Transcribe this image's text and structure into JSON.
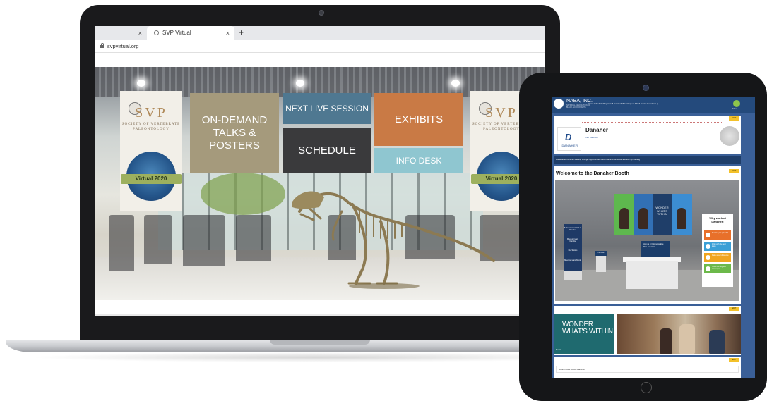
{
  "browser": {
    "tabs": [
      {
        "label": ""
      },
      {
        "label": "SVP Virtual"
      }
    ],
    "new_tab": "+",
    "close": "×",
    "url": "svpvirtual.org"
  },
  "svp_lobby": {
    "banner_left": {
      "logo": "SVP",
      "subtitle": "SOCIETY OF VERTEBRATE PALEONTOLOGY",
      "ribbon": "Virtual 2020"
    },
    "banner_right": {
      "logo": "SVP",
      "subtitle": "SOCIETY OF VERTEBRATE PALEONTOLOGY",
      "ribbon": "Virtual 2020"
    },
    "tiles": {
      "on_demand": "ON-DEMAND TALKS & POSTERS",
      "next_live": "NEXT LIVE SESSION",
      "schedule": "SCHEDULE",
      "exhibits": "EXHIBITS",
      "info_desk": "INFO DESK"
    }
  },
  "naba": {
    "org_name": "NABA, INC.",
    "org_sub": "NATIONAL ASSOCIATION OF BLACK ACCOUNTANTS",
    "nav": "Home   Schedule   Programs & Events ▾   Virtual Expo ▾   NABA Center   Help Desk  |  ",
    "hello": "Hello ▾",
    "edit_label": "EDIT",
    "company": "Danaher",
    "company_logo": "DANAHER",
    "links": "Info    Calendar",
    "menu": "Home   About Danaher   Meeting Lounge   Opportunities Within Danaher   Schedule a Follow Up Meeting",
    "welcome": "Welcome to the Danaher Booth",
    "kiosk_left": [
      "5 Reasons to Work at Danaher",
      "Meet our team Caroline",
      "Our Stories",
      "Meet our team Nicole"
    ],
    "counter_screen": "Join us in helping realize life's potential",
    "small_kiosk": "Fact Flow",
    "photo_wall_text": "WONDER WHAT'S WITHIN",
    "tower": {
      "title": "Why work at Danaher:",
      "items": [
        {
          "label": "Realize your potential",
          "color": "#e8702a"
        },
        {
          "label": "Work with the best team",
          "color": "#3ca0d6"
        },
        {
          "label": "Make a real difference",
          "color": "#f0a51f"
        },
        {
          "label": "Solve the toughest challenges",
          "color": "#6cb94a"
        }
      ]
    },
    "wonder_card": "WONDER WHAT'S WITHIN",
    "carousel_dots": "●○○",
    "learn_more": "Learn More About Danaher",
    "collapse": "−"
  }
}
